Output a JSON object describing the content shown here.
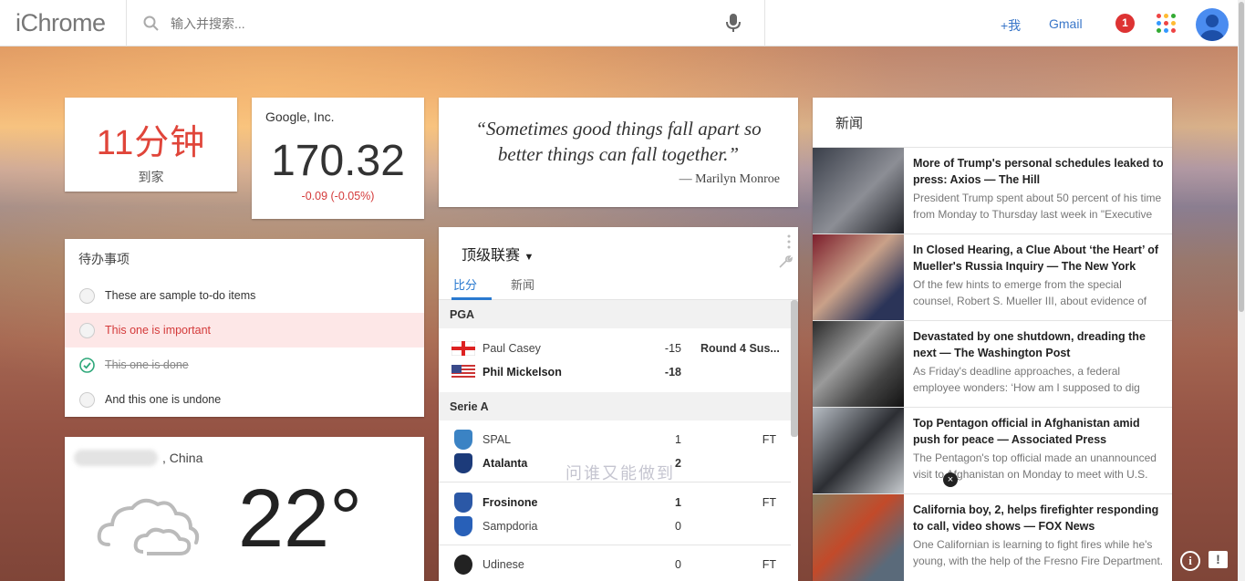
{
  "app": {
    "logo": "iChrome"
  },
  "search": {
    "placeholder": "输入并搜索..."
  },
  "header": {
    "plus_me": "+我",
    "gmail": "Gmail",
    "notifications": "1"
  },
  "eta": {
    "value": "11分钟",
    "label": "到家"
  },
  "stock": {
    "company": "Google, Inc.",
    "price": "170.32",
    "change": "-0.09 (-0.05%)"
  },
  "quote": {
    "text": "“Sometimes good things fall apart so better things can fall together.”",
    "author": "— Marilyn Monroe"
  },
  "todo": {
    "title": "待办事项",
    "items": [
      {
        "label": "These are sample to-do items",
        "state": "normal"
      },
      {
        "label": "This one is important",
        "state": "important"
      },
      {
        "label": "This one is done",
        "state": "done"
      },
      {
        "label": "And this one is undone",
        "state": "normal"
      }
    ]
  },
  "weather": {
    "location": ", China",
    "temperature": "22°"
  },
  "sports": {
    "league": "顶级联赛",
    "tabs": [
      "比分",
      "新闻"
    ],
    "sections": [
      {
        "name": "PGA",
        "players": [
          {
            "name": "Paul Casey",
            "score": "-15",
            "flag": "england"
          },
          {
            "name": "Phil Mickelson",
            "score": "-18",
            "flag": "usa"
          }
        ],
        "status": "Round 4 Sus..."
      },
      {
        "name": "Serie A"
      }
    ],
    "matches": [
      {
        "home": "SPAL",
        "home_score": "1",
        "away": "Atalanta",
        "away_score": "2",
        "status": "FT"
      },
      {
        "home": "Frosinone",
        "home_score": "1",
        "away": "Sampdoria",
        "away_score": "0",
        "status": "FT"
      },
      {
        "home": "Udinese",
        "home_score": "0",
        "status": "FT"
      }
    ]
  },
  "news": {
    "title": "新闻",
    "items": [
      {
        "headline": "More of Trump's personal schedules leaked to press: Axios — The Hill",
        "desc": "President Trump spent about 50 percent of his time from Monday to Thursday last week in \"Executive"
      },
      {
        "headline": "In Closed Hearing, a Clue About ‘the Heart’ of Mueller's Russia Inquiry — The New York",
        "desc": "Of the few hints to emerge from the special counsel, Robert S. Mueller III, about evidence of"
      },
      {
        "headline": "Devastated by one shutdown, dreading the next — The Washington Post",
        "desc": "As Friday's deadline approaches, a federal employee wonders: ‘How am I supposed to dig"
      },
      {
        "headline": "Top Pentagon official in Afghanistan amid push for peace — Associated Press",
        "desc": "The Pentagon's top official made an unannounced visit to Afghanistan on Monday to meet with U.S."
      },
      {
        "headline": "California boy, 2, helps firefighter responding to call, video shows — FOX News",
        "desc": "One Californian is learning to fight fires while he's young, with the help of the Fresno Fire Department."
      }
    ]
  },
  "overlay": {
    "watermark": "问谁又能做到",
    "close": "×",
    "info": "i",
    "feedback": "!"
  },
  "colors": {
    "accent": "#2a7ad0",
    "negative": "#d43a3a",
    "eta": "#e0453a"
  }
}
